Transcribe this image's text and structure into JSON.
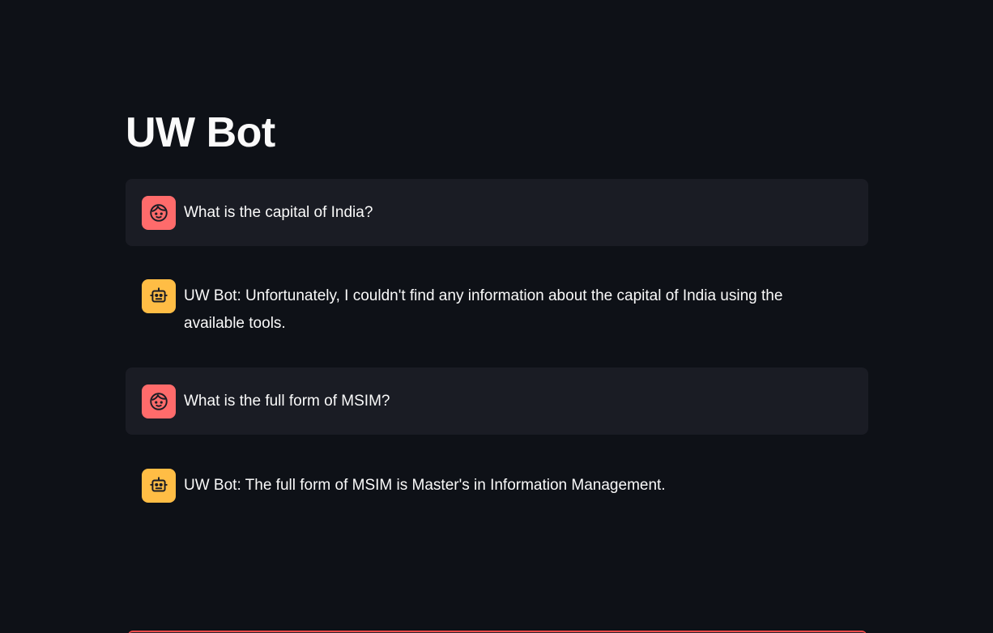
{
  "app": {
    "title": "UW Bot"
  },
  "messages": [
    {
      "role": "user",
      "avatar_icon": "user-face-icon",
      "text": "What is the capital of India?"
    },
    {
      "role": "assistant",
      "avatar_icon": "robot-icon",
      "text": "UW Bot: Unfortunately, I couldn't find any information about the capital of India using the available tools."
    },
    {
      "role": "user",
      "avatar_icon": "user-face-icon",
      "text": "What is the full form of MSIM?"
    },
    {
      "role": "assistant",
      "avatar_icon": "robot-icon",
      "text": "UW Bot: The full form of MSIM is Master's in Information Management."
    }
  ],
  "colors": {
    "background": "#0e1117",
    "user_message_bg": "#1a1c24",
    "user_avatar": "#ff6b6b",
    "bot_avatar": "#ffbd45",
    "accent": "#ff4b4b",
    "text": "#fafafa"
  }
}
